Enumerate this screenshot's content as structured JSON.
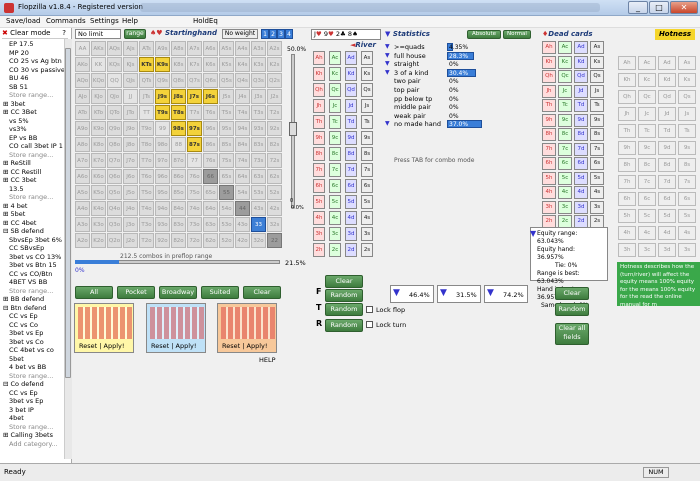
{
  "window": {
    "title": "Flopzilla v1.8.4 - Registered version"
  },
  "menu": [
    "Save/load",
    "Commands",
    "Settings",
    "Help",
    "HoldEq"
  ],
  "left": {
    "header": "Clear mode",
    "qmark": "?",
    "items": [
      "EP 17.5",
      "MP 20",
      "CO 25 vs Ag btn",
      "CO 30 vs passive",
      "BU 46",
      "SB 51",
      "Store range...",
      "⊞ 3bet",
      "⊞ CC 3Bet",
      "vs 5%",
      "vs3%",
      "EP vs BB",
      "CO call 3bet IP 1",
      "Store range...",
      "⊞ ReStill",
      "⊞ CC Restill",
      "⊞ CC 3bet",
      "13.5",
      "Store range...",
      "⊞ 4 bet",
      "⊞ 5bet",
      "⊞ CC 4bet",
      "⊟ SB defend",
      "SbvsEp 3bet 6%",
      "CC SBvsEp",
      "3bet vs CO 13%",
      "3bet vs Btn 15",
      "CC vs CO/Btn",
      "4BET VS BB",
      "Store range...",
      "⊞ BB defend",
      "⊟ Btn defend",
      "CC vs Ep",
      "CC vs Co",
      "3bet vs Ep",
      "3bet vs Co",
      "CC 4bet vs co",
      "5bet",
      "4 bet vs BB",
      "Store range...",
      "⊟ Co defend",
      "CC vs Ep",
      "3bet vs Ep",
      "3 bet IP",
      "4bet",
      "Store range...",
      "⊞ Calling 3bets",
      "Add category..."
    ]
  },
  "topbar": {
    "limit": "No limit",
    "range": "range",
    "starting": "Startinghand",
    "noweight": "No weight",
    "weights": [
      "1",
      "2",
      "3",
      "4"
    ]
  },
  "grid": {
    "ranks": [
      "A",
      "K",
      "Q",
      "J",
      "T",
      "9",
      "8",
      "7",
      "6",
      "5",
      "4",
      "3",
      "2"
    ],
    "selected": [
      "KTs",
      "K9s",
      "J9s",
      "J8s",
      "T9s",
      "T8s",
      "98s",
      "97s",
      "87s",
      "J7s",
      "J6s"
    ],
    "blue": [
      "33"
    ],
    "dark": [
      "66",
      "55",
      "44",
      "22"
    ]
  },
  "slider": {
    "top": "50.0%",
    "mid": "0",
    "bot": "0.0%",
    "hpct": "21.5%",
    "hmin": "0%",
    "combos": "212.5 combos in preflop range"
  },
  "buttons": {
    "all": "All",
    "pocket": "Pocket",
    "broadway": "Broadway",
    "suited": "Suited",
    "clear": "Clear",
    "reset": "Reset",
    "apply": "Apply!",
    "help": "HELP"
  },
  "board": {
    "label": "River",
    "cards": [
      "J",
      "9",
      "2",
      "8"
    ],
    "clear": "Clear",
    "random": "Random",
    "lockflop": "Lock flop",
    "lockturn": "Lock turn"
  },
  "cards": {
    "ranks": [
      "A",
      "K",
      "Q",
      "J",
      "T",
      "9",
      "8",
      "7",
      "6",
      "5",
      "4",
      "3",
      "2"
    ],
    "suits": [
      "h",
      "c",
      "d",
      "s"
    ]
  },
  "stats": {
    "title": "Statistics",
    "absolute": "Absolute",
    "normal": "Normal",
    "rows": [
      {
        "l": ">=quads",
        "v": "4.35%",
        "w": 4
      },
      {
        "l": "full house",
        "v": "28.3%",
        "w": 28
      },
      {
        "l": "straight",
        "v": "0%",
        "w": 0
      },
      {
        "l": "3 of a kind",
        "v": "30.4%",
        "w": 30
      },
      {
        "l": "two pair",
        "v": "0%",
        "w": 0
      },
      {
        "l": "top pair",
        "v": "0%",
        "w": 0
      },
      {
        "l": "pp below tp",
        "v": "0%",
        "w": 0
      },
      {
        "l": "middle pair",
        "v": "0%",
        "w": 0
      },
      {
        "l": "weak pair",
        "v": "0%",
        "w": 0
      },
      {
        "l": "no made hand",
        "v": "37.0%",
        "w": 37
      }
    ],
    "tab": "Press TAB for combo mode",
    "filters": [
      "46.4%",
      "31.5%",
      "74.2%"
    ]
  },
  "dead": {
    "title": "Dead cards",
    "equity": [
      "Equity range: 63.043%",
      "Equity hand: 36.957%",
      "Tie: 0%",
      "Range is best: 63.043%",
      "Hand is best: 36.957%",
      "Same hand: 0%"
    ],
    "clear": "Clear",
    "random": "Random",
    "clearall": "Clear all fields"
  },
  "hot": {
    "title": "Hotness",
    "note": "Hotness describes how the (turn/river) will affect the equity means 100% equity for the means 100% equity for the read the online manual for m"
  },
  "status": {
    "ready": "Ready",
    "num": "NUM"
  }
}
